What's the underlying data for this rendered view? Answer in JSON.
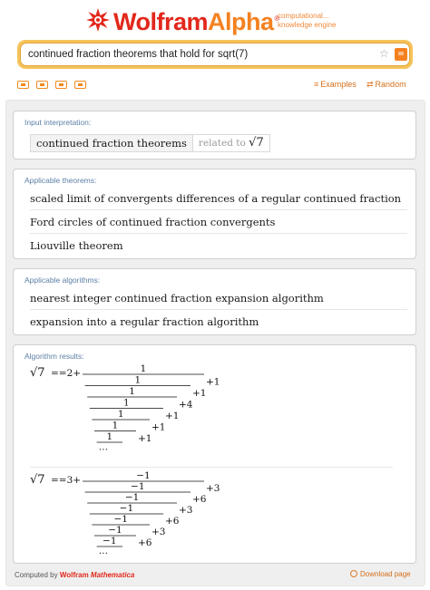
{
  "header": {
    "logo_wolfram": "Wolfram",
    "logo_alpha": "Alpha",
    "logo_reg": "®",
    "tagline_line1": "computational...",
    "tagline_line2": "knowledge engine",
    "icon_star": "star-icon",
    "icon_go": "equals-icon"
  },
  "search": {
    "value": "continued fraction theorems that hold for sqrt(7)",
    "favorite_icon": "☆",
    "go_icon": "="
  },
  "toolbar": {
    "examples_label": "Examples",
    "random_label": "Random"
  },
  "pods": {
    "input": {
      "title": "Input interpretation:",
      "main": "continued fraction theorems",
      "related": "related to",
      "related_value": "√7"
    },
    "theorems": {
      "title": "Applicable theorems:",
      "items": [
        "scaled limit of convergents differences of a regular continued fraction",
        "Ford circles of continued fraction convergents",
        "Liouville theorem"
      ]
    },
    "algorithms": {
      "title": "Applicable algorithms:",
      "items": [
        "nearest integer continued fraction expansion algorithm",
        "expansion into a regular fraction algorithm"
      ]
    },
    "results": {
      "title": "Algorithm results:",
      "cf1": {
        "lhs": "√7",
        "eq": "==",
        "lead": "2",
        "plus": "+",
        "num": "1",
        "addends": [
          "1",
          "1",
          "4",
          "1",
          "1",
          "1"
        ],
        "tail": "…"
      },
      "cf2": {
        "lhs": "√7",
        "eq": "==",
        "lead": "3",
        "plus": "+",
        "num": "−1",
        "addends": [
          "3",
          "6",
          "3",
          "6",
          "3",
          "6"
        ],
        "tail": "…"
      }
    }
  },
  "footer": {
    "computed_by": "Computed by",
    "wolfram": "Wolfram",
    "mathematica": "Mathematica",
    "download": "Download page"
  },
  "colors": {
    "brand_red": "#e2271b",
    "brand_orange": "#f48120",
    "pod_title": "#5b7fa6"
  }
}
